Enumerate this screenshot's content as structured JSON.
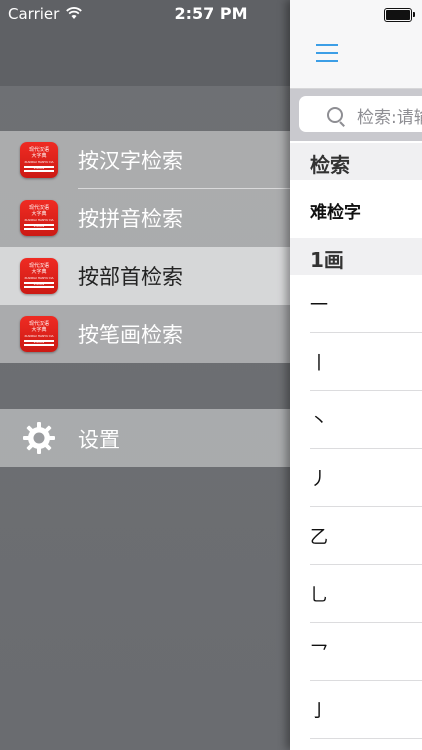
{
  "status_bar": {
    "carrier": "Carrier",
    "time": "2:57 PM"
  },
  "drawer": {
    "items": [
      {
        "label": "按汉字检索",
        "icon_lines": [
          "现代汉语",
          "大字典",
          "XIANDAI HANYU DA ZIDIAN"
        ]
      },
      {
        "label": "按拼音检索",
        "icon_lines": [
          "现代汉语",
          "大字典",
          "XIANDAI HANYU DA ZIDIAN"
        ]
      },
      {
        "label": "按部首检索",
        "icon_lines": [
          "现代汉语",
          "大字典",
          "XIANDAI HANYU DA ZIDIAN"
        ]
      },
      {
        "label": "按笔画检索",
        "icon_lines": [
          "现代汉语",
          "大字典",
          "XIANDAI HANYU DA ZIDIAN"
        ]
      }
    ],
    "settings_label": "设置"
  },
  "panel": {
    "search_placeholder": "检索:请输入",
    "sections": [
      {
        "title": "检索",
        "rows": [
          "难检字"
        ]
      },
      {
        "title": "1画",
        "rows": [
          "一",
          "丨",
          "丶",
          "丿",
          "乙",
          "乚",
          "乛",
          "亅"
        ]
      }
    ]
  },
  "colors": {
    "accent": "#3c9ee6",
    "icon_red": "#e1231c",
    "drawer_bg": "#6e7074"
  }
}
